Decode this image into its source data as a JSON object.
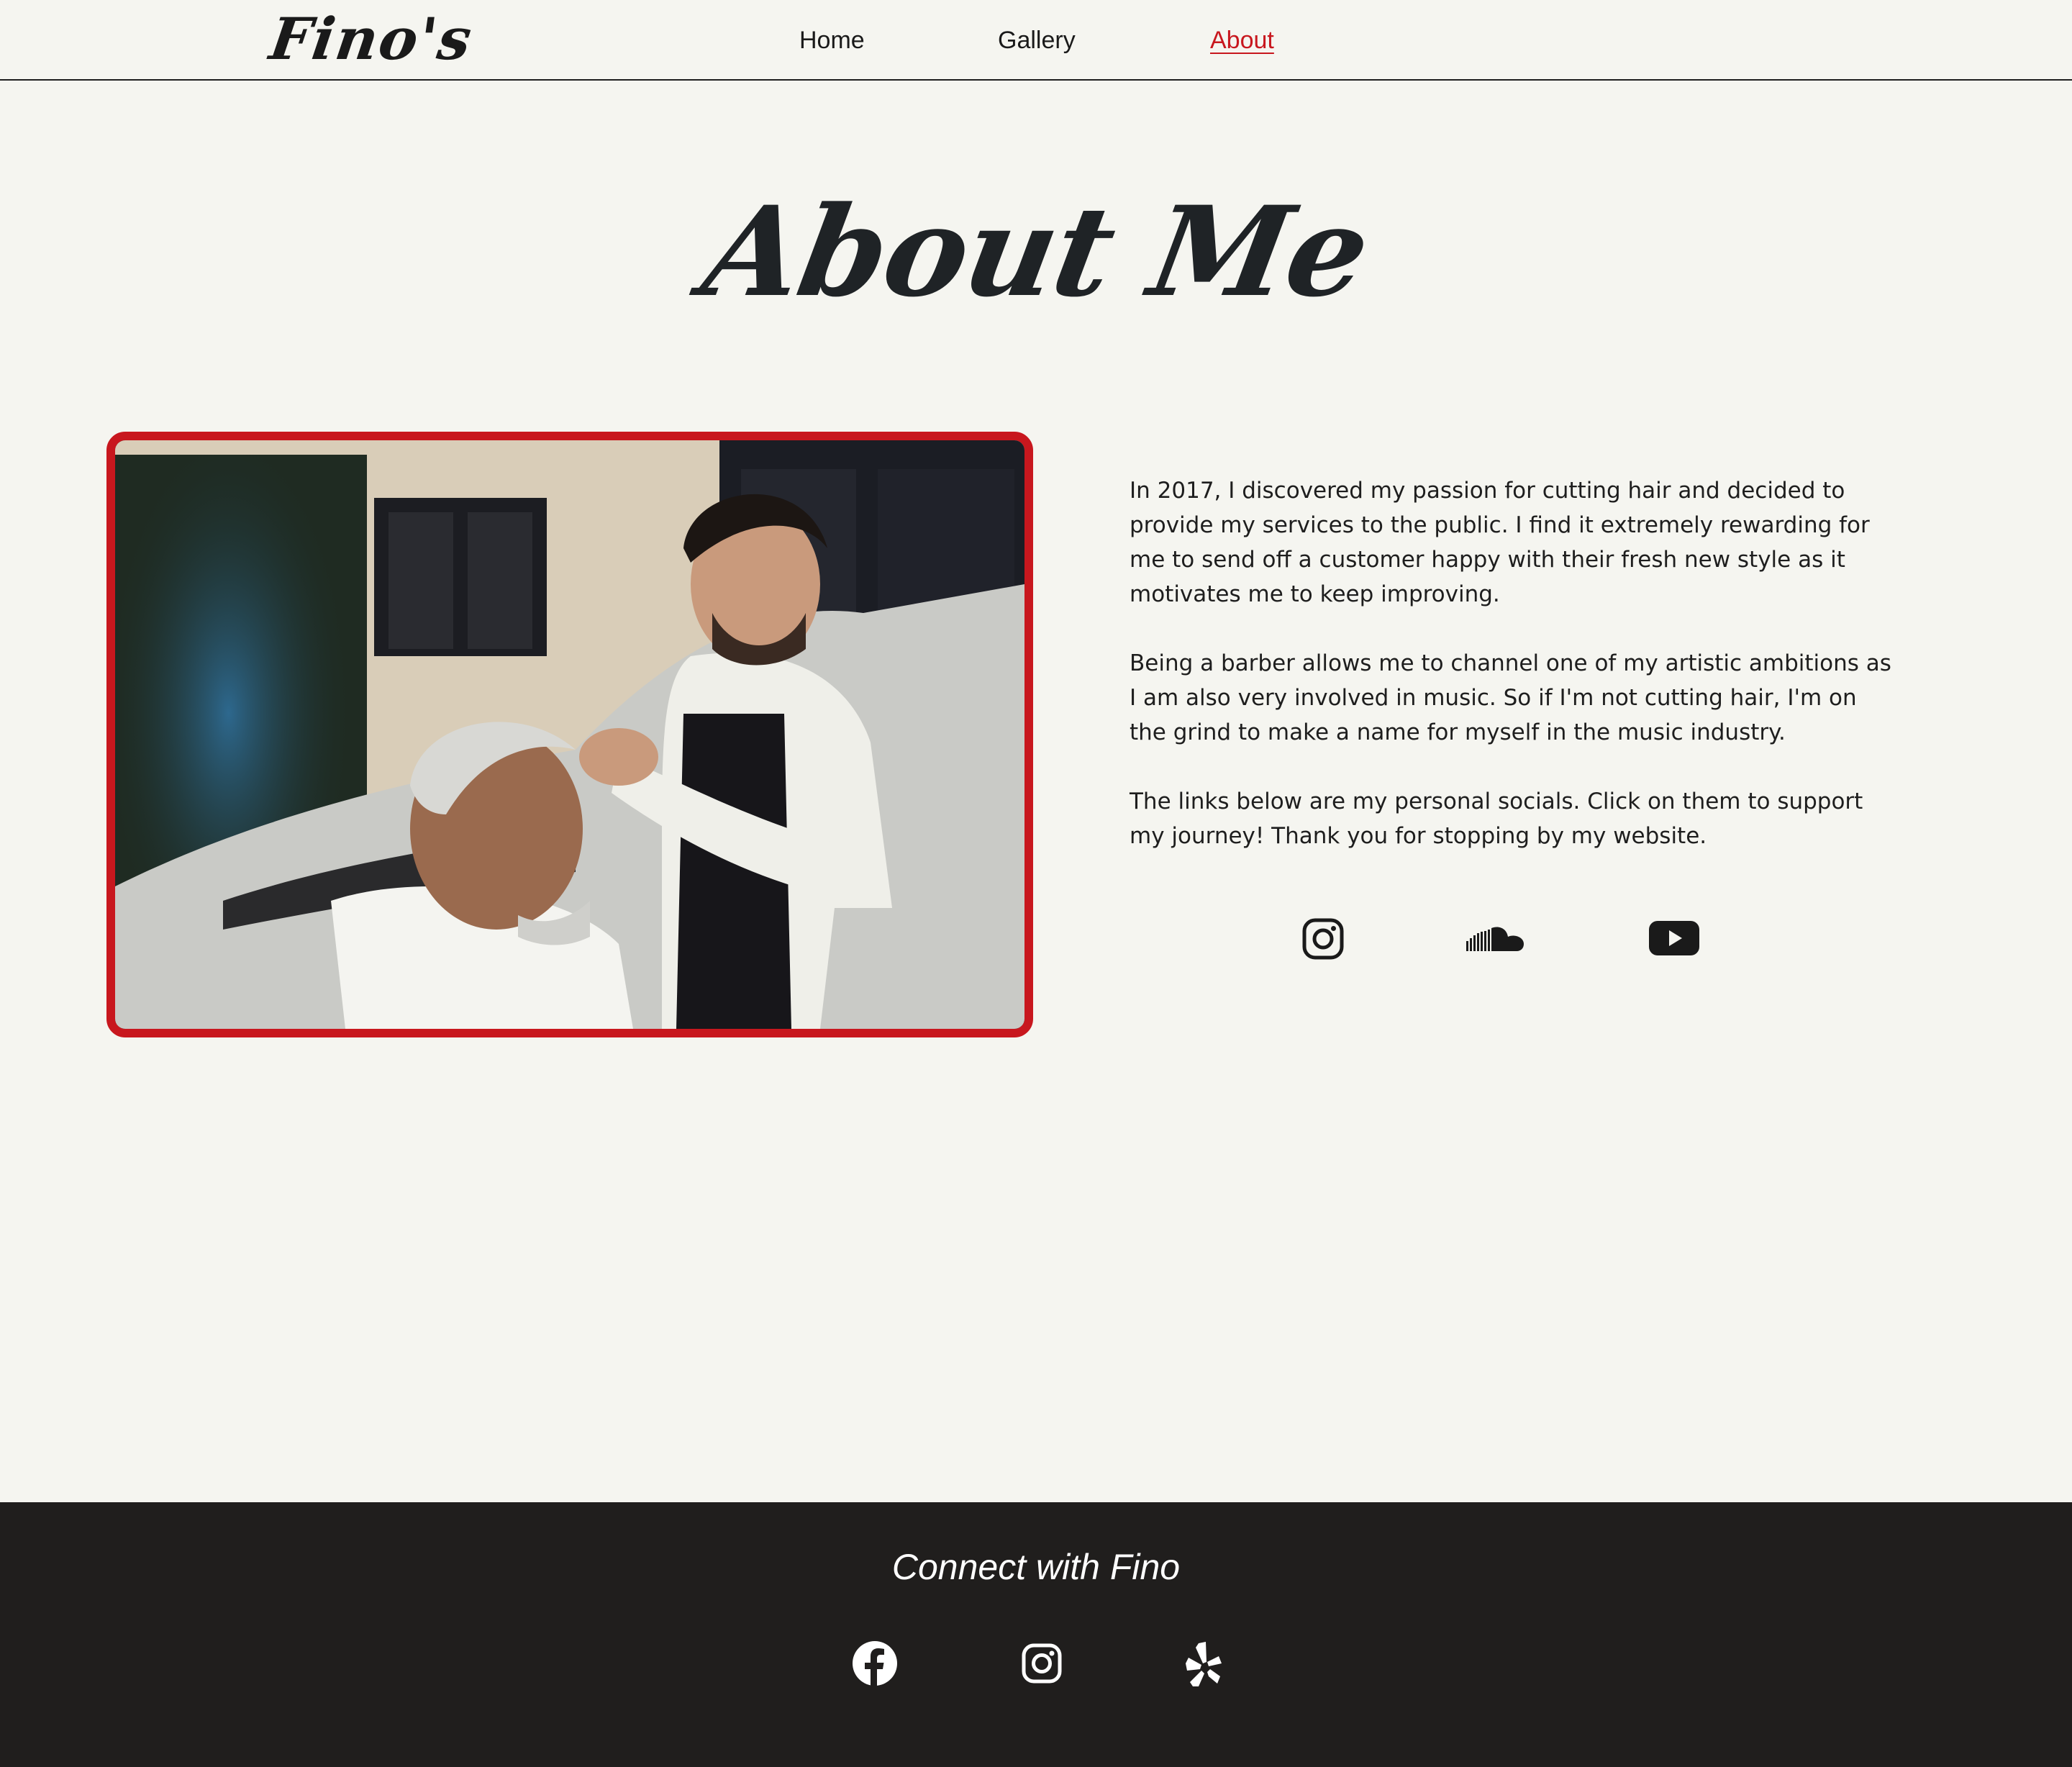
{
  "brand": {
    "logo_text": "Fino's"
  },
  "nav": {
    "home": "Home",
    "gallery": "Gallery",
    "about": "About",
    "active": "About",
    "active_color": "#c8171e"
  },
  "page": {
    "title": "About Me"
  },
  "photo": {
    "frame_color": "#c8171e"
  },
  "bio": {
    "paragraphs": [
      "In 2017, I discovered my passion for cutting hair and decided to provide my services to the public. I find it extremely rewarding for me to send off a customer happy with their fresh new style as it motivates me to keep improving.",
      "Being a barber allows me to channel one of my artistic ambitions as I am also very involved in music. So if I'm not cutting hair, I'm on the grind to make a name for myself in the music industry.",
      "The links below are my personal socials. Click on them to support my journey! Thank you for stopping by my website."
    ],
    "socials": [
      "instagram-icon",
      "soundcloud-icon",
      "youtube-icon"
    ]
  },
  "footer": {
    "title": "Connect with Fino",
    "background": "#201e1d",
    "socials": [
      "facebook-icon",
      "instagram-icon",
      "yelp-icon"
    ]
  }
}
